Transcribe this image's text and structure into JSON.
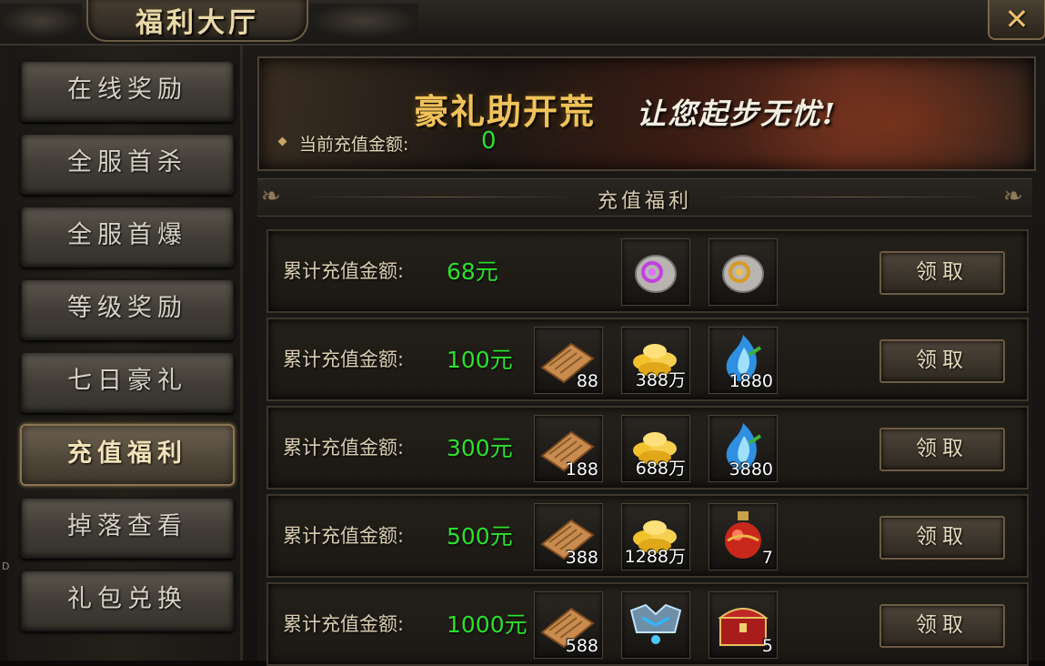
{
  "window": {
    "title": "福利大厅",
    "close_icon": "✕"
  },
  "sidebar": {
    "items": [
      {
        "label": "在线奖励",
        "active": false
      },
      {
        "label": "全服首杀",
        "active": false
      },
      {
        "label": "全服首爆",
        "active": false
      },
      {
        "label": "等级奖励",
        "active": false
      },
      {
        "label": "七日豪礼",
        "active": false
      },
      {
        "label": "充值福利",
        "active": true
      },
      {
        "label": "掉落查看",
        "active": false
      },
      {
        "label": "礼包兑换",
        "active": false
      }
    ]
  },
  "banner": {
    "headline_main": "豪礼助开荒",
    "headline_sub": "让您起步无忧!",
    "recharge_label": "当前充值金额:",
    "recharge_value": "0"
  },
  "section": {
    "title": "充值福利"
  },
  "rows": [
    {
      "label": "累计充值金额:",
      "amount": "68元",
      "claim": "领取",
      "items": [
        {
          "icon": "purple-scroll-icon",
          "qty": ""
        },
        {
          "icon": "gold-scroll-icon",
          "qty": ""
        }
      ]
    },
    {
      "label": "累计充值金额:",
      "amount": "100元",
      "claim": "领取",
      "items": [
        {
          "icon": "parchment-icon",
          "qty": "88"
        },
        {
          "icon": "gold-ingot-icon",
          "qty": "388万"
        },
        {
          "icon": "blue-flame-icon",
          "qty": "1880"
        }
      ]
    },
    {
      "label": "累计充值金额:",
      "amount": "300元",
      "claim": "领取",
      "items": [
        {
          "icon": "parchment-icon",
          "qty": "188"
        },
        {
          "icon": "gold-ingot-icon",
          "qty": "688万"
        },
        {
          "icon": "blue-flame-icon",
          "qty": "3880"
        }
      ]
    },
    {
      "label": "累计充值金额:",
      "amount": "500元",
      "claim": "领取",
      "items": [
        {
          "icon": "parchment-icon",
          "qty": "388"
        },
        {
          "icon": "gold-ingot-icon",
          "qty": "1288万"
        },
        {
          "icon": "red-potion-icon",
          "qty": "7"
        }
      ]
    },
    {
      "label": "累计充值金额:",
      "amount": "1000元",
      "claim": "领取",
      "items": [
        {
          "icon": "parchment-icon",
          "qty": "588"
        },
        {
          "icon": "armor-icon",
          "qty": ""
        },
        {
          "icon": "treasure-chest-icon",
          "qty": "5"
        }
      ]
    }
  ],
  "edge_mark": "D",
  "colors": {
    "amount_green": "#2de02d",
    "title_gold": "#e9d9a8"
  }
}
